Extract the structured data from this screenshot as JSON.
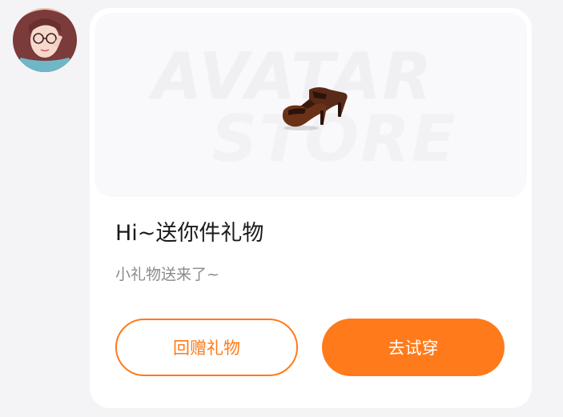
{
  "avatar": {
    "icon": "user-avatar-photo"
  },
  "gift_card": {
    "banner": {
      "watermark_line1": "AVATAR",
      "watermark_line2": "STORE",
      "item_icon": "high-heel-shoes"
    },
    "title": "Hi~送你件礼物",
    "subtitle": "小礼物送来了~",
    "return_gift_label": "回赠礼物",
    "try_on_label": "去试穿"
  },
  "colors": {
    "accent": "#ff7a1a",
    "background": "#f4f4f6",
    "card": "#ffffff",
    "title_text": "#1a1a1a",
    "subtitle_text": "#8a8a8f"
  }
}
